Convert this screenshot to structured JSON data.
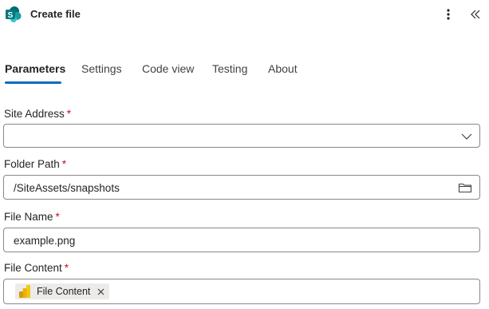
{
  "header": {
    "title": "Create file",
    "app_icon": "sharepoint-icon",
    "more_icon": "more-vertical-icon",
    "collapse_icon": "chevron-double-left-icon"
  },
  "tabs": [
    {
      "label": "Parameters",
      "active": true
    },
    {
      "label": "Settings",
      "active": false
    },
    {
      "label": "Code view",
      "active": false
    },
    {
      "label": "Testing",
      "active": false
    },
    {
      "label": "About",
      "active": false
    }
  ],
  "fields": {
    "site_address": {
      "label": "Site Address",
      "required_mark": "*",
      "value": "",
      "icon": "chevron-down-icon"
    },
    "folder_path": {
      "label": "Folder Path",
      "required_mark": "*",
      "value": "/SiteAssets/snapshots",
      "icon": "folder-icon"
    },
    "file_name": {
      "label": "File Name",
      "required_mark": "*",
      "value": "example.png"
    },
    "file_content": {
      "label": "File Content",
      "required_mark": "*",
      "token": {
        "label": "File Content",
        "icon": "powerbi-icon",
        "remove_icon": "close-icon"
      }
    }
  },
  "colors": {
    "accent": "#0f6cbd",
    "required": "#c50f1f",
    "border": "#8a8886",
    "token_bg": "#edebe9"
  }
}
